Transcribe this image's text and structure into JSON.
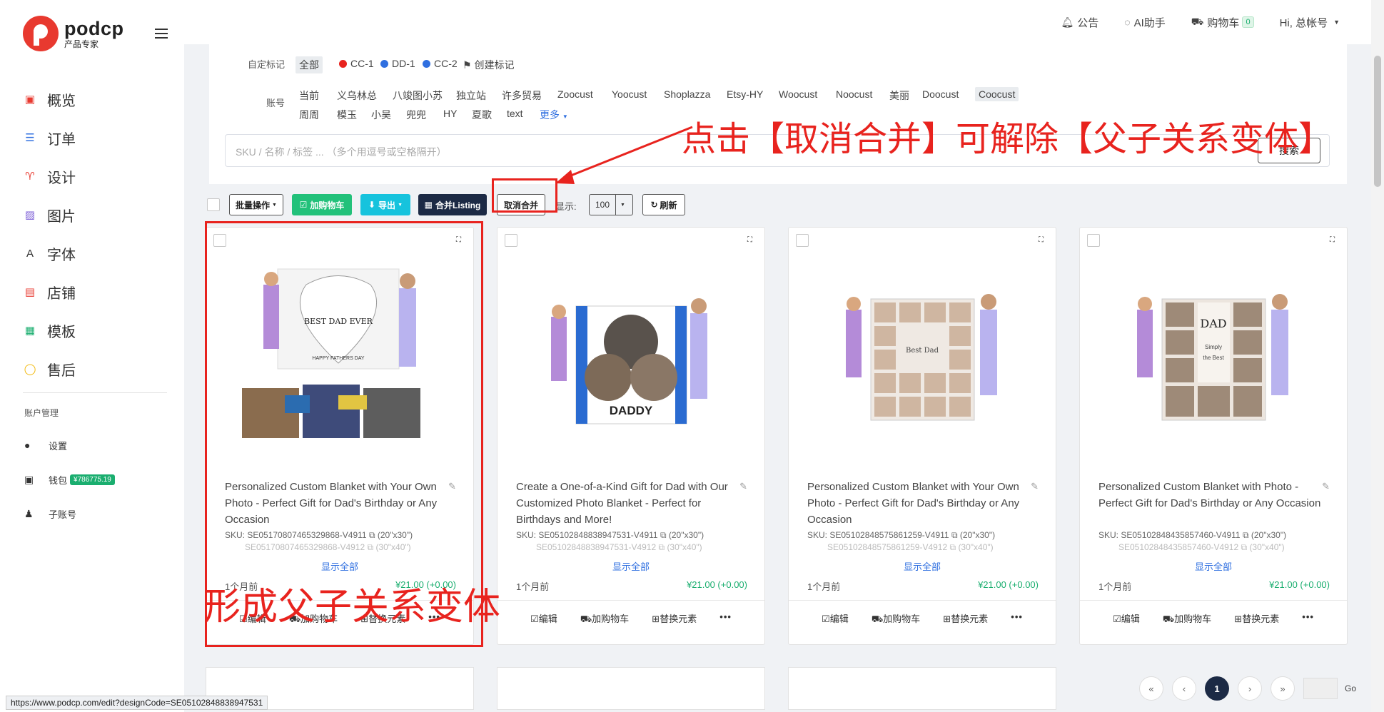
{
  "brand": {
    "name": "podcp",
    "subtitle": "产品专家"
  },
  "nav": [
    {
      "label": "概览",
      "icon": "monitor-icon",
      "color": "#e8392f"
    },
    {
      "label": "订单",
      "icon": "list-icon",
      "color": "#2f6fe0"
    },
    {
      "label": "设计",
      "icon": "shirt-icon",
      "color": "#e8392f"
    },
    {
      "label": "图片",
      "icon": "image-icon",
      "color": "#7b5cd6"
    },
    {
      "label": "字体",
      "icon": "font-icon",
      "color": "#333333"
    },
    {
      "label": "店铺",
      "icon": "store-icon",
      "color": "#e8392f"
    },
    {
      "label": "模板",
      "icon": "template-icon",
      "color": "#1aae6f"
    },
    {
      "label": "售后",
      "icon": "chat-icon",
      "color": "#f2b705"
    }
  ],
  "account": {
    "title": "账户管理",
    "items": [
      {
        "label": "设置",
        "icon": "user-icon"
      },
      {
        "label": "钱包",
        "icon": "wallet-icon",
        "badge": "¥786775.19"
      },
      {
        "label": "子账号",
        "icon": "subaccount-icon"
      }
    ]
  },
  "topbar": {
    "notice": "公告",
    "ai": "AI助手",
    "cart": "购物车",
    "cart_count": "0",
    "user": "Hi, 总帐号"
  },
  "filters": {
    "mark_label": "自定标记",
    "marks": [
      {
        "label": "全部",
        "active": true
      },
      {
        "label": "CC-1",
        "dot": "#e8231e"
      },
      {
        "label": "DD-1",
        "dot": "#2f6fe0"
      },
      {
        "label": "CC-2",
        "dot": "#2f6fe0"
      },
      {
        "label": "创建标记",
        "icon": "flag-icon"
      }
    ],
    "account_label": "账号",
    "accounts_row1": [
      "当前",
      "义乌林总",
      "八竣图小苏",
      "独立站",
      "许多贸易",
      "Zoocust",
      "Yoocust",
      "Shoplazza",
      "Etsy-HY",
      "Woocust",
      "Noocust",
      "美丽",
      "Doocust",
      "Coocust"
    ],
    "accounts_row2": [
      "周周",
      "模玉",
      "小吴",
      "兜兜",
      "HY",
      "夏歌",
      "text"
    ],
    "more": "更多",
    "search_placeholder": "SKU / 名称 / 标签 ... （多个用逗号或空格隔开）",
    "search_button": "搜索"
  },
  "toolbar": {
    "batch": "批量操作",
    "add_cart": "加购物车",
    "export": "导出",
    "merge": "合并Listing",
    "unmerge": "取消合并",
    "show_label": "显示:",
    "page_size": "100",
    "refresh": "刷新"
  },
  "cards": [
    {
      "title": "Personalized Custom Blanket with Your Own Photo - Perfect Gift for Dad's Birthday or Any Occasion",
      "sku": "SKU: SE05170807465329868-V4911",
      "size1": "(20\"x30\")",
      "sku2": "SE05170807465329868-V4912",
      "size2": "(30\"x40\")",
      "show_all": "显示全部",
      "age": "1个月前",
      "price": "¥21.00 (+0.00)",
      "actions": [
        "编辑",
        "加购物车",
        "替换元素",
        "•••"
      ]
    },
    {
      "title": "Create a One-of-a-Kind Gift for Dad with Our Customized Photo Blanket - Perfect for Birthdays and More!",
      "sku": "SKU: SE05102848838947531-V4911",
      "size1": "(20\"x30\")",
      "sku2": "SE05102848838947531-V4912",
      "size2": "(30\"x40\")",
      "show_all": "显示全部",
      "age": "1个月前",
      "price": "¥21.00 (+0.00)",
      "actions": [
        "编辑",
        "加购物车",
        "替换元素",
        "•••"
      ]
    },
    {
      "title": "Personalized Custom Blanket with Your Own Photo - Perfect Gift for Dad's Birthday or Any Occasion",
      "sku": "SKU: SE05102848575861259-V4911",
      "size1": "(20\"x30\")",
      "sku2": "SE05102848575861259-V4912",
      "size2": "(30\"x40\")",
      "show_all": "显示全部",
      "age": "1个月前",
      "price": "¥21.00 (+0.00)",
      "actions": [
        "编辑",
        "加购物车",
        "替换元素",
        "•••"
      ]
    },
    {
      "title": "Personalized Custom Blanket with Photo - Perfect Gift for Dad's Birthday or Any Occasion",
      "sku": "SKU: SE05102848435857460-V4911",
      "size1": "(20\"x30\")",
      "sku2": "SE05102848435857460-V4912",
      "size2": "(30\"x40\")",
      "show_all": "显示全部",
      "age": "1个月前",
      "price": "¥21.00 (+0.00)",
      "actions": [
        "编辑",
        "加购物车",
        "替换元素",
        "•••"
      ]
    }
  ],
  "annotations": {
    "top": "点击【取消合并】可解除【父子关系变体】",
    "bottom": "形成父子关系变体",
    "color": "#e8231e"
  },
  "pagination": {
    "first": "«",
    "prev": "‹",
    "current": "1",
    "next": "›",
    "last": "»",
    "go": "Go"
  },
  "status_url": "https://www.podcp.com/edit?designCode=SE05102848838947531",
  "colors": {
    "accent": "#1c2a45",
    "green": "#22c17a",
    "cyan": "#16c3dd",
    "price": "#1aae6f",
    "link": "#2f6fe0"
  }
}
